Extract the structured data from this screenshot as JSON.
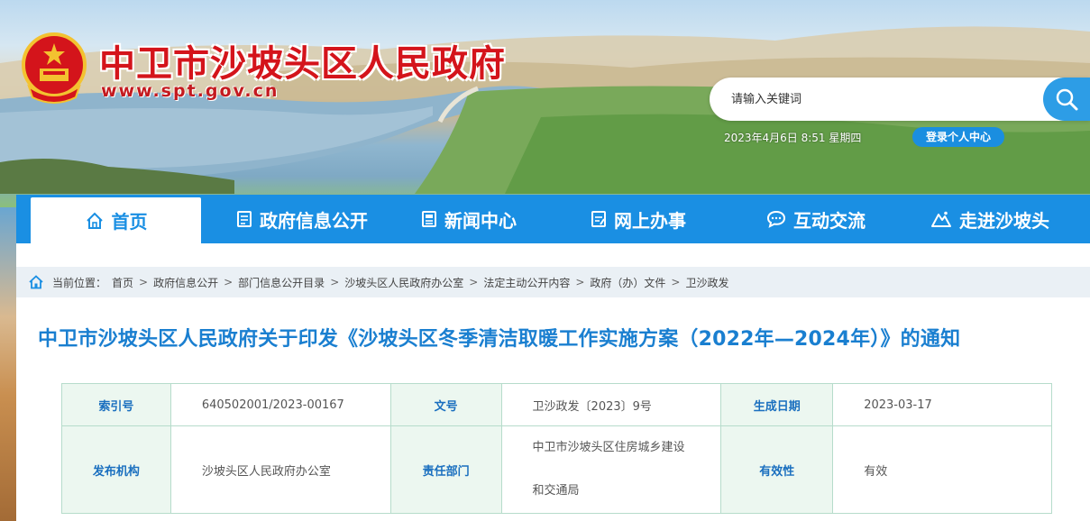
{
  "header": {
    "site_title": "中卫市沙坡头区人民政府",
    "site_url": "www.spt.gov.cn",
    "search_placeholder": "请输入关键词",
    "datetime": "2023年4月6日 8:51 星期四",
    "login_label": "登录个人中心"
  },
  "nav": {
    "items": [
      {
        "label": "首页",
        "icon": "home-icon",
        "active": true
      },
      {
        "label": "政府信息公开",
        "icon": "document-icon"
      },
      {
        "label": "新闻中心",
        "icon": "news-icon"
      },
      {
        "label": "网上办事",
        "icon": "edit-form-icon"
      },
      {
        "label": "互动交流",
        "icon": "chat-icon"
      },
      {
        "label": "走进沙坡头",
        "icon": "mountain-icon"
      }
    ]
  },
  "breadcrumb": {
    "label": "当前位置：",
    "items": [
      "首页",
      "政府信息公开",
      "部门信息公开目录",
      "沙坡头区人民政府办公室",
      "法定主动公开内容",
      "政府（办）文件",
      "卫沙政发"
    ]
  },
  "document": {
    "title": "中卫市沙坡头区人民政府关于印发《沙坡头区冬季清洁取暖工作实施方案（2022年—2024年）》的通知",
    "meta": {
      "index_label": "索引号",
      "index_value": "640502001/2023-00167",
      "docno_label": "文号",
      "docno_value": "卫沙政发〔2023〕9号",
      "date_label": "生成日期",
      "date_value": "2023-03-17",
      "publisher_label": "发布机构",
      "publisher_value": "沙坡头区人民政府办公室",
      "dept_label": "责任部门",
      "dept_value_line1": "中卫市沙坡头区住房城乡建设",
      "dept_value_line2": "和交通局",
      "validity_label": "有效性",
      "validity_value": "有效"
    }
  },
  "colors": {
    "title_red": "#d4141b",
    "nav_blue": "#1a8fe3",
    "doc_title_blue": "#1a7fd0",
    "table_border": "#b6dccb"
  }
}
